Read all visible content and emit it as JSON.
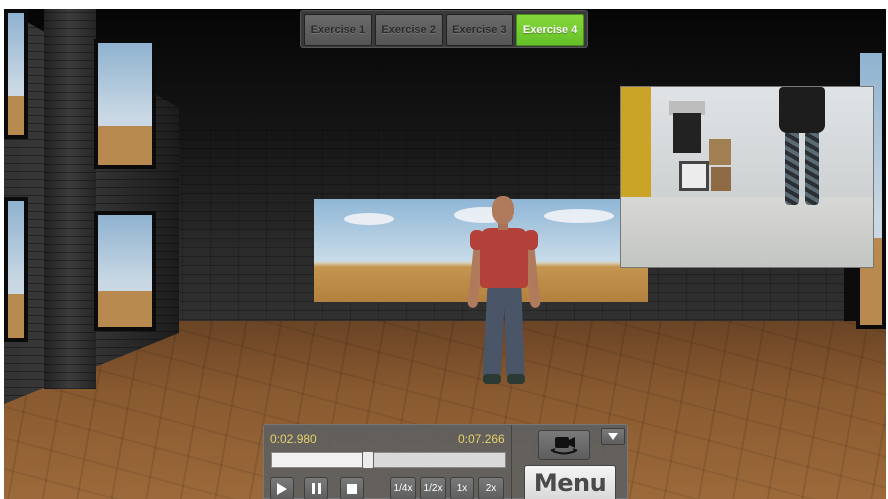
{
  "tabs": [
    {
      "label": "Exercise 1",
      "active": false
    },
    {
      "label": "Exercise 2",
      "active": false
    },
    {
      "label": "Exercise 3",
      "active": false
    },
    {
      "label": "Exercise 4",
      "active": true
    }
  ],
  "player": {
    "current_time": "0:02.980",
    "total_time": "0:07.266",
    "progress": 0.41,
    "speed_options": [
      "1/4x",
      "1/2x",
      "1x",
      "2x"
    ],
    "menu_label": "Menu"
  },
  "colors": {
    "active_tab": "#66c02a",
    "time_text": "#e6d36a"
  },
  "icons": [
    "play-icon",
    "pause-icon",
    "stop-icon",
    "switch-camera-icon",
    "collapse-arrow-icon"
  ]
}
